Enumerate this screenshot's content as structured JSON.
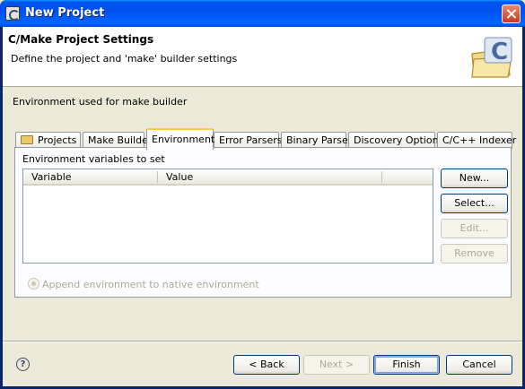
{
  "window": {
    "title": "New Project"
  },
  "header": {
    "title": "C/Make Project Settings",
    "description": "Define the project and 'make' builder settings"
  },
  "section_label": "Environment used for make builder",
  "tabs": [
    {
      "label": "Projects"
    },
    {
      "label": "Make Builder"
    },
    {
      "label": "Environment"
    },
    {
      "label": "Error Parsers"
    },
    {
      "label": "Binary Parser"
    },
    {
      "label": "Discovery Options"
    },
    {
      "label": "C/C++ Indexer"
    }
  ],
  "environment": {
    "label": "Environment variables to set",
    "columns": [
      "Variable",
      "Value"
    ],
    "buttons": {
      "new": "New...",
      "select": "Select...",
      "edit": "Edit...",
      "remove": "Remove"
    },
    "append_option": "Append environment to native environment"
  },
  "footer": {
    "help": "?",
    "back": "< Back",
    "next": "Next >",
    "finish": "Finish",
    "cancel": "Cancel"
  }
}
